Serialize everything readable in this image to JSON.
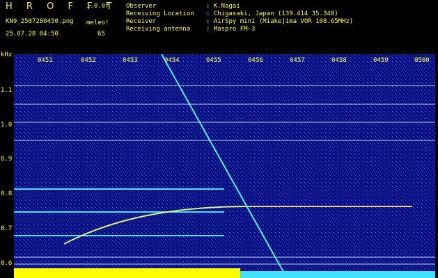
{
  "header": {
    "brand": "H R O F F T",
    "version": "1.0.0f",
    "filename": "KN9_2507280450.png",
    "meteor_label": "meleo!",
    "datetime": "25.07.28 04:50",
    "meteor_count": "65",
    "fields": [
      {
        "label": "Observer",
        "value": ": K.Nagai"
      },
      {
        "label": "Receiving Location",
        "value": ": Chigasaki, Japan (139.414 35.340)"
      },
      {
        "label": "Receiver",
        "value": ": AirSpy mini (Miakejima VOR 108.65MHz)"
      },
      {
        "label": "Receiving antenna",
        "value": ": Maspro FM-3"
      }
    ]
  },
  "chart_data": {
    "type": "spectrogram",
    "ylabel": "kHz",
    "y_ticks": [
      "1.1",
      "1.0",
      "0.9",
      "0.8",
      "0.7",
      "0.6"
    ],
    "x_ticks": [
      "0451",
      "0452",
      "0453",
      "0454",
      "0455",
      "0456",
      "0457",
      "0458",
      "0459",
      "0500"
    ],
    "colors": {
      "background": "#0a1080",
      "text": "#ffff40",
      "signal": "#40d0ff",
      "meteor": "#ffffff"
    }
  }
}
